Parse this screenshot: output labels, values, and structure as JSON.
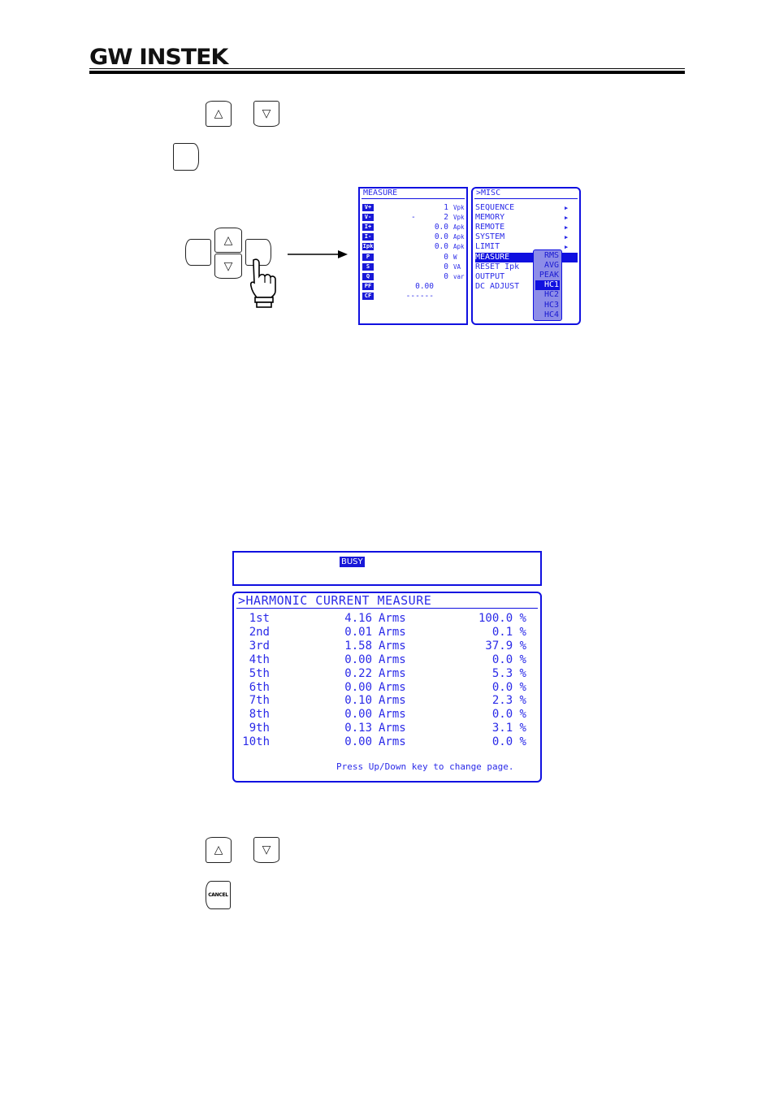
{
  "header": {
    "logo": "GW INSTEK"
  },
  "step1": {
    "up_key": "△",
    "down_key": "▽"
  },
  "step2": {
    "blank_key": ""
  },
  "illustration": {
    "keypad": {
      "up": "△",
      "down": "▽"
    },
    "measure_panel": {
      "title": "MEASURE",
      "rows": [
        {
          "label": "V+",
          "sign": "",
          "value": "1",
          "unit": "Vpk"
        },
        {
          "label": "V-",
          "sign": "-",
          "value": "2",
          "unit": "Vpk"
        },
        {
          "label": "I+",
          "sign": "",
          "value": "0.0",
          "unit": "Apk"
        },
        {
          "label": "I-",
          "sign": "",
          "value": "0.0",
          "unit": "Apk"
        },
        {
          "label": "Ipk",
          "sign": "",
          "value": "0.0",
          "unit": "Apk"
        },
        {
          "label": "P",
          "sign": "",
          "value": "0",
          "unit": "W"
        },
        {
          "label": "S",
          "sign": "",
          "value": "0",
          "unit": "VA"
        },
        {
          "label": "Q",
          "sign": "",
          "value": "0",
          "unit": "var"
        },
        {
          "label": "PF",
          "sign": "",
          "value": "0.00",
          "unit": ""
        },
        {
          "label": "CF",
          "sign": "",
          "value": "------",
          "unit": ""
        }
      ]
    },
    "misc_panel": {
      "title": ">MISC",
      "items": [
        {
          "label": "SEQUENCE",
          "arrow": "▶"
        },
        {
          "label": "MEMORY",
          "arrow": "▶"
        },
        {
          "label": "REMOTE",
          "arrow": "▶"
        },
        {
          "label": "SYSTEM",
          "arrow": "▶"
        },
        {
          "label": "LIMIT",
          "arrow": "▶"
        },
        {
          "label": "MEASURE",
          "arrow": ""
        },
        {
          "label": "RESET Ipk",
          "arrow": ""
        },
        {
          "label": "OUTPUT",
          "arrow": ""
        },
        {
          "label": "DC ADJUST",
          "arrow": ""
        }
      ],
      "selected": "MEASURE",
      "submenu": [
        "RMS",
        "AVG",
        "PEAK",
        "HC1",
        "HC2",
        "HC3",
        "HC4"
      ],
      "submenu_selected": "HC1"
    }
  },
  "status_panel": {
    "busy": "BUSY"
  },
  "harmonic_panel": {
    "title": ">HARMONIC CURRENT MEASURE",
    "rows": [
      {
        "order": "1st",
        "current": "4.16",
        "unit": "Arms",
        "percent": "100.0 %"
      },
      {
        "order": "2nd",
        "current": "0.01",
        "unit": "Arms",
        "percent": "0.1 %"
      },
      {
        "order": "3rd",
        "current": "1.58",
        "unit": "Arms",
        "percent": "37.9 %"
      },
      {
        "order": "4th",
        "current": "0.00",
        "unit": "Arms",
        "percent": "0.0 %"
      },
      {
        "order": "5th",
        "current": "0.22",
        "unit": "Arms",
        "percent": "5.3 %"
      },
      {
        "order": "6th",
        "current": "0.00",
        "unit": "Arms",
        "percent": "0.0 %"
      },
      {
        "order": "7th",
        "current": "0.10",
        "unit": "Arms",
        "percent": "2.3 %"
      },
      {
        "order": "8th",
        "current": "0.00",
        "unit": "Arms",
        "percent": "0.0 %"
      },
      {
        "order": "9th",
        "current": "0.13",
        "unit": "Arms",
        "percent": "3.1 %"
      },
      {
        "order": "10th",
        "current": "0.00",
        "unit": "Arms",
        "percent": "0.0 %"
      }
    ],
    "footer": "Press Up/Down key to change page."
  },
  "step3": {
    "up_key": "△",
    "down_key": "▽"
  },
  "step4": {
    "cancel_key": "CANCEL"
  }
}
